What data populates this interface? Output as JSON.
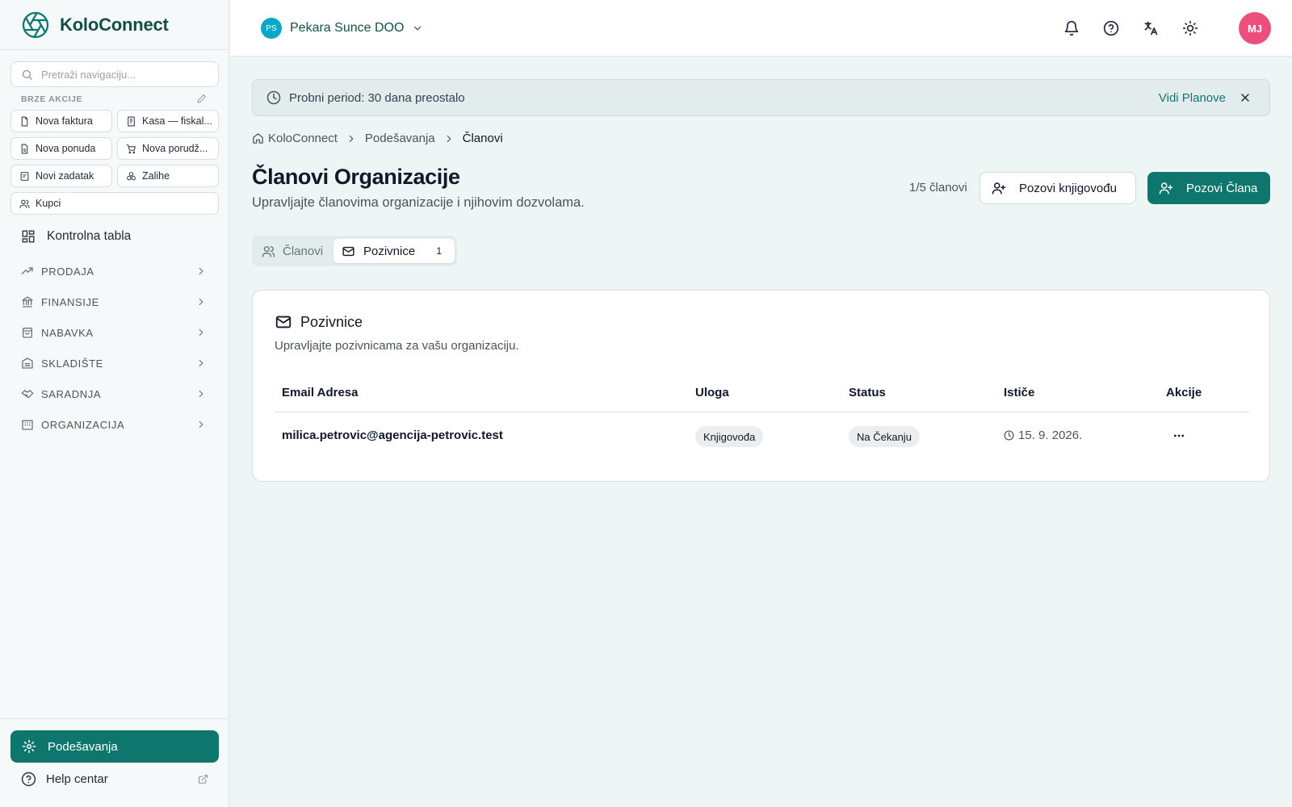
{
  "app": {
    "name": "KoloConnect"
  },
  "sidebar": {
    "search_placeholder": "Pretraži navigaciju...",
    "quick_actions_label": "BRZE AKCIJE",
    "quick_actions": [
      {
        "label": "Nova faktura",
        "icon": "file-icon"
      },
      {
        "label": "Kasa — fiskal...",
        "icon": "receipt-icon"
      },
      {
        "label": "Nova ponuda",
        "icon": "file-text-icon"
      },
      {
        "label": "Nova porudž...",
        "icon": "cart-icon"
      },
      {
        "label": "Novi zadatak",
        "icon": "task-icon"
      },
      {
        "label": "Zalihe",
        "icon": "boxes-icon"
      },
      {
        "label": "Kupci",
        "icon": "users-icon"
      }
    ],
    "dashboard_label": "Kontrolna tabla",
    "groups": [
      {
        "label": "PRODAJA",
        "icon": "trending-up-icon"
      },
      {
        "label": "FINANSIJE",
        "icon": "bank-icon"
      },
      {
        "label": "NABAVKA",
        "icon": "shopping-bag-icon"
      },
      {
        "label": "SKLADIŠTE",
        "icon": "warehouse-icon"
      },
      {
        "label": "SARADNJA",
        "icon": "handshake-icon"
      },
      {
        "label": "ORGANIZACIJA",
        "icon": "building-icon"
      }
    ],
    "settings_label": "Podešavanja",
    "help_label": "Help centar"
  },
  "header": {
    "org_initials": "PS",
    "org_name": "Pekara Sunce DOO",
    "user_initials": "MJ"
  },
  "trial": {
    "message": "Probni period: 30 dana preostalo",
    "plans_link": "Vidi Planove"
  },
  "breadcrumb": [
    "KoloConnect",
    "Podešavanja",
    "Članovi"
  ],
  "page": {
    "title": "Članovi Organizacije",
    "subtitle": "Upravljajte članovima organizacije i njihovim dozvolama.",
    "member_count": "1/5 članovi",
    "invite_accountant": "Pozovi knjigovođu",
    "invite_member": "Pozovi Člana"
  },
  "tabs": [
    {
      "label": "Članovi"
    },
    {
      "label": "Pozivnice",
      "count": "1"
    }
  ],
  "invitations": {
    "title": "Pozivnice",
    "subtitle": "Upravljajte pozivnicama za vašu organizaciju.",
    "columns": [
      "Email Adresa",
      "Uloga",
      "Status",
      "Ističe",
      "Akcije"
    ],
    "rows": [
      {
        "email": "milica.petrovic@agencija-petrovic.test",
        "role": "Knjigovođa",
        "status": "Na Čekanju",
        "expires": "15. 9. 2026."
      }
    ]
  },
  "colors": {
    "primary": "#0f766e",
    "avatar": "#ec4f7a",
    "org_badge": "#06a8c9"
  }
}
